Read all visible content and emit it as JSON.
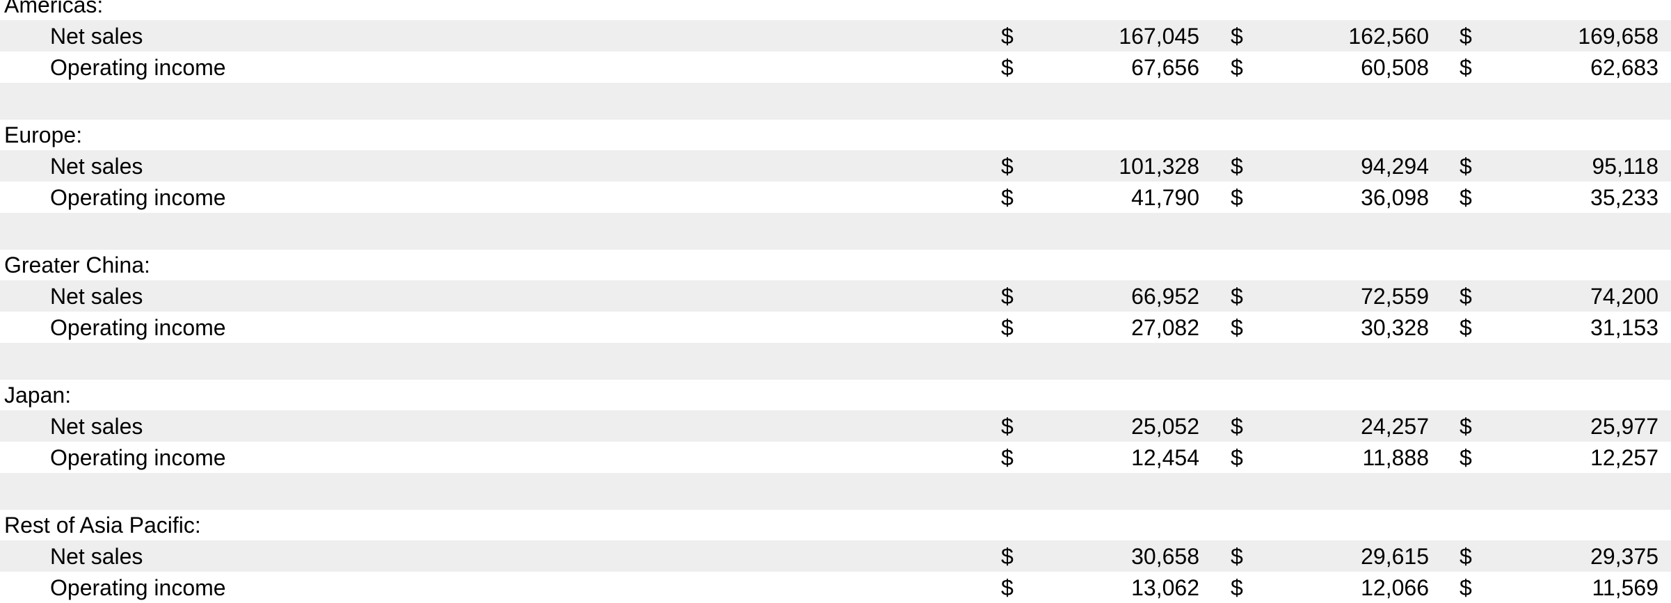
{
  "currency_symbol": "$",
  "regions": [
    {
      "name": "Americas:",
      "rows": [
        {
          "label": "Net sales",
          "values": [
            "167,045",
            "162,560",
            "169,658"
          ]
        },
        {
          "label": "Operating income",
          "values": [
            "67,656",
            "60,508",
            "62,683"
          ]
        }
      ]
    },
    {
      "name": "Europe:",
      "rows": [
        {
          "label": "Net sales",
          "values": [
            "101,328",
            "94,294",
            "95,118"
          ]
        },
        {
          "label": "Operating income",
          "values": [
            "41,790",
            "36,098",
            "35,233"
          ]
        }
      ]
    },
    {
      "name": "Greater China:",
      "rows": [
        {
          "label": "Net sales",
          "values": [
            "66,952",
            "72,559",
            "74,200"
          ]
        },
        {
          "label": "Operating income",
          "values": [
            "27,082",
            "30,328",
            "31,153"
          ]
        }
      ]
    },
    {
      "name": "Japan:",
      "rows": [
        {
          "label": "Net sales",
          "values": [
            "25,052",
            "24,257",
            "25,977"
          ]
        },
        {
          "label": "Operating income",
          "values": [
            "12,454",
            "11,888",
            "12,257"
          ]
        }
      ]
    },
    {
      "name": "Rest of Asia Pacific:",
      "rows": [
        {
          "label": "Net sales",
          "values": [
            "30,658",
            "29,615",
            "29,375"
          ]
        },
        {
          "label": "Operating income",
          "values": [
            "13,062",
            "12,066",
            "11,569"
          ]
        }
      ]
    }
  ],
  "colors": {
    "shaded_row": "#eeeeee",
    "background": "#ffffff",
    "text": "#000000"
  }
}
